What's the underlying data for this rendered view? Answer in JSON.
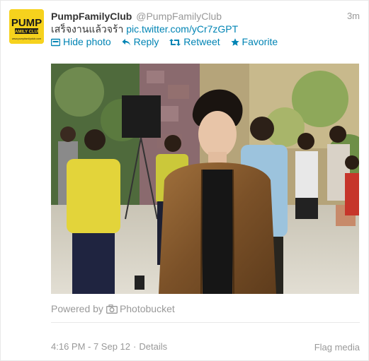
{
  "tweet": {
    "fullname": "PumpFamilyClub",
    "username": "@PumpFamilyClub",
    "time": "3m",
    "text": "เสร็จงานแล้วจร้า",
    "link": "pic.twitter.com/yCr7zGPT"
  },
  "avatar": {
    "logo_text": "PUMP",
    "logo_subtext": "FAMILY CLUB",
    "logo_url_text": "www.pumpfamilyclub.com"
  },
  "actions": {
    "hide_photo": "Hide photo",
    "reply": "Reply",
    "retweet": "Retweet",
    "favorite": "Favorite"
  },
  "media": {
    "powered_prefix": "Powered by",
    "provider": "Photobucket"
  },
  "footer": {
    "timestamp": "4:16 PM - 7 Sep 12",
    "separator": "·",
    "details": "Details",
    "flag_media": "Flag media"
  },
  "colors": {
    "link": "#0084b4",
    "muted": "#999999",
    "name": "#333333"
  }
}
